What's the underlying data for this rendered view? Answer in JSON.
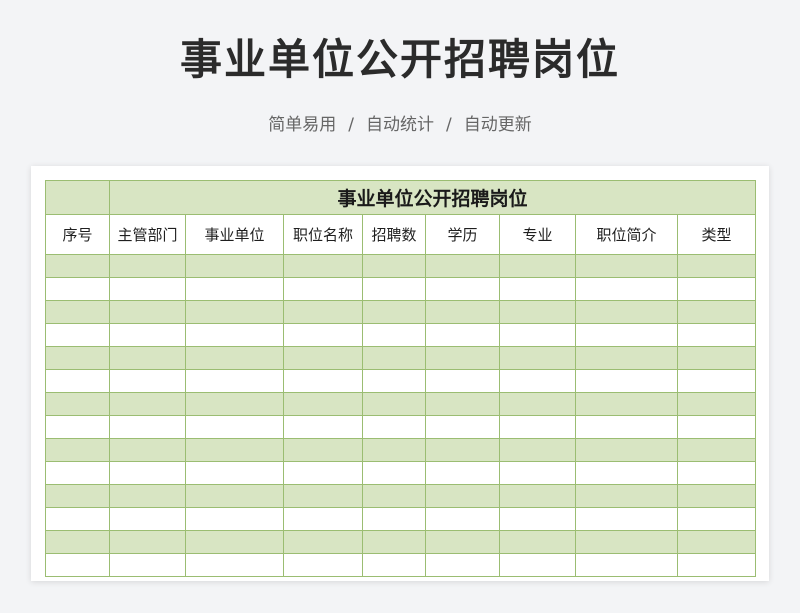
{
  "page": {
    "title": "事业单位公开招聘岗位",
    "tags": [
      "简单易用",
      "自动统计",
      "自动更新"
    ],
    "separator": "/"
  },
  "sheet": {
    "title": "事业单位公开招聘岗位",
    "headers": [
      "序号",
      "主管部门",
      "事业单位",
      "职位名称",
      "招聘数",
      "学历",
      "专业",
      "职位简介",
      "类型"
    ],
    "row_count": 14,
    "header_fill": "#d8e5c3",
    "border_color": "#9bbd72"
  }
}
